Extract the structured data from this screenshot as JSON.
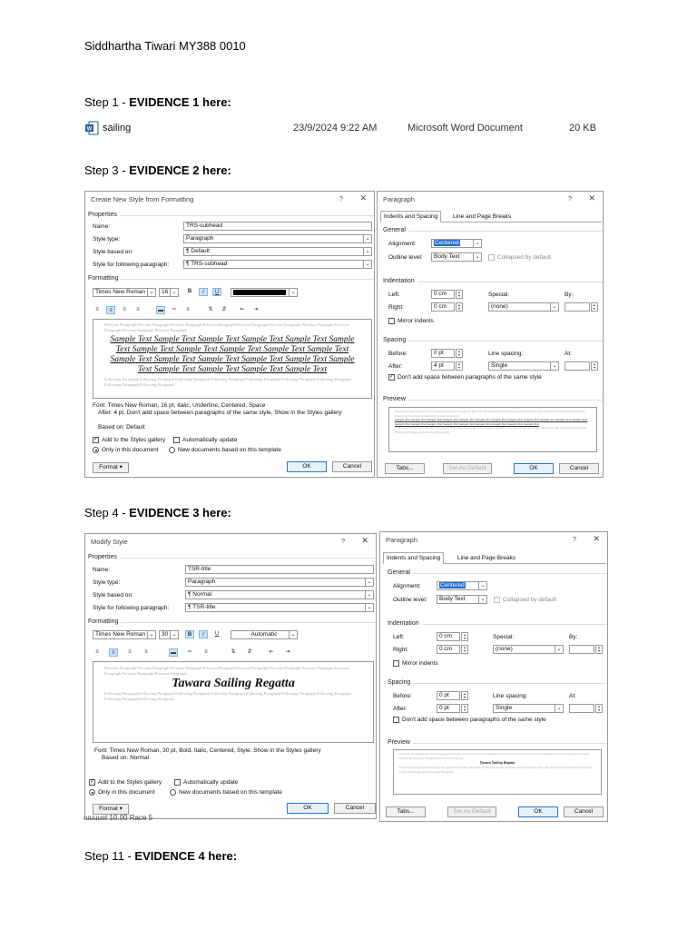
{
  "header": {
    "author": "Siddhartha Tiwari MY388 0010"
  },
  "steps": [
    {
      "prefix": "Step 1 - ",
      "bold": "EVIDENCE 1 here:"
    },
    {
      "prefix": "Step 3 - ",
      "bold": "EVIDENCE 2 here:"
    },
    {
      "prefix": "Step 4 - ",
      "bold": "EVIDENCE 3 here:"
    },
    {
      "prefix": "Step 11 - ",
      "bold": "EVIDENCE 4 here:"
    }
  ],
  "file_row": {
    "name": "sailing",
    "date": "23/9/2024 9:22 AM",
    "type": "Microsoft Word Document",
    "size": "20 KB"
  },
  "common": {
    "help": "?",
    "close": "✕",
    "properties": "Properties",
    "formatting": "Formatting",
    "name_label": "Name:",
    "style_type_label": "Style type:",
    "style_based_label": "Style based on:",
    "style_following_label": "Style for following paragraph:",
    "font": "Times New Roman",
    "bold_btn": "B",
    "italic_btn": "I",
    "underline_btn": "U",
    "add_gallery": "Add to the Styles gallery",
    "auto_update": "Automatically update",
    "only_doc": "Only in this document",
    "new_docs": "New documents based on this template",
    "format_btn": "Format ▾",
    "ok": "OK",
    "cancel": "Cancel",
    "ghost_prev": "Previous Paragraph Previous Paragraph Previous Paragraph Previous Paragraph Previous Paragraph Previous Paragraph Previous Paragraph Previous Paragraph Previous Paragraph Previous Paragraph",
    "ghost_follow": "Following Paragraph Following Paragraph Following Paragraph Following Paragraph Following Paragraph Following Paragraph Following Paragraph Following Paragraph Following Paragraph"
  },
  "dialog1": {
    "title": "Create New Style from Formatting",
    "name": "TRS-subhead",
    "style_type": "Paragraph",
    "based_on": "¶  Default",
    "following": "¶  TRS-subhead",
    "size": "16",
    "sample": "Sample Text Sample Text Sample Text Sample Text Sample Text Sample Text Sample Text Sample Text Sample Text Sample Text Sample Text Sample Text Sample Text Sample Text Sample Text Sample Text Sample Text Sample Text Sample Text Sample Text Sample Text",
    "desc1": "Font: Times New Roman, 16 pt, Italic, Underline, Centered, Space",
    "desc2": "After:  4 pt, Don't add space between paragraphs of the same style, Show in the Styles gallery",
    "desc3": "Based on: Default"
  },
  "dialog2": {
    "title": "Paragraph",
    "tab1": "Indents and Spacing",
    "tab2": "Line and Page Breaks",
    "general": "General",
    "alignment_label": "Alignment:",
    "alignment": "Centered",
    "outline_label": "Outline level:",
    "outline": "Body Text",
    "collapsed": "Collapsed by default",
    "indentation": "Indentation",
    "left_label": "Left:",
    "left": "0 cm",
    "right_label": "Right:",
    "right": "0 cm",
    "special_label": "Special:",
    "special": "(none)",
    "by_label": "By:",
    "mirror": "Mirror indents",
    "spacing": "Spacing",
    "before_label": "Before:",
    "before": "0 pt",
    "after_label": "After:",
    "after": "4 pt",
    "line_spacing_label": "Line spacing:",
    "line_spacing": "Single",
    "at_label": "At:",
    "dont_add": "Don't add space between paragraphs of the same style",
    "preview": "Preview",
    "tabs_btn": "Tabs...",
    "default_btn": "Set As Default"
  },
  "dialog3": {
    "title": "Modify Style",
    "name": "TSR-title",
    "style_type": "Paragraph",
    "based_on": "¶  Normal",
    "following": "¶  TSR-title",
    "size": "30",
    "color": "Automatic",
    "sample": "Tawara Sailing Regatta",
    "desc1": "Font: Times New Roman, 30 pt, Bold, Italic, Centered, Style: Show in the Styles gallery",
    "desc2": "Based on: Normal"
  },
  "dialog4": {
    "title": "Paragraph",
    "after": "0 pt",
    "special": "(none)",
    "preview_sample": "Tawara Sailing Regatta"
  },
  "background_text": "ıuuuust    10.00    Race 5"
}
